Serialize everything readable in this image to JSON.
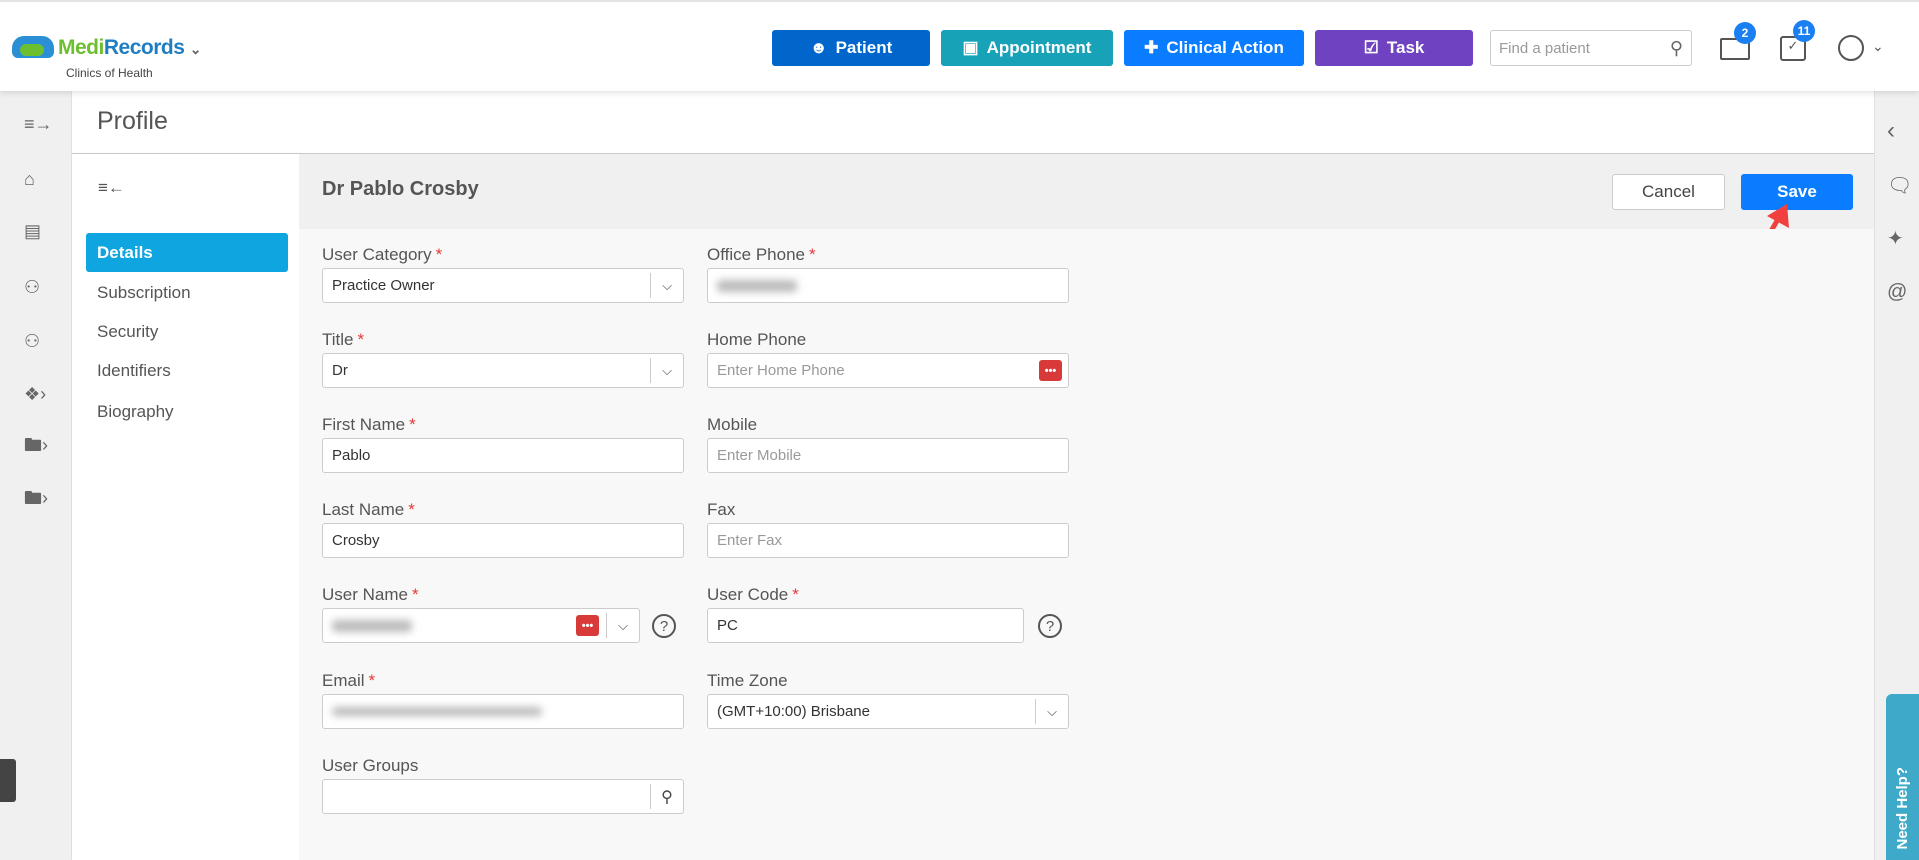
{
  "header": {
    "brand_medi": "Medi",
    "brand_records": "Records",
    "clinic": "Clinics of Health",
    "buttons": [
      {
        "label": "Patient",
        "color": "#0066cc"
      },
      {
        "label": "Appointment",
        "color": "#17a2b8"
      },
      {
        "label": "Clinical Action",
        "color": "#0a7cff"
      },
      {
        "label": "Task",
        "color": "#6f42c1"
      }
    ],
    "search_placeholder": "Find a patient",
    "mail_count": "2",
    "calendar_count": "11"
  },
  "page_title": "Profile",
  "subnav": [
    "Details",
    "Subscription",
    "Security",
    "Identifiers",
    "Biography"
  ],
  "profile_name": "Dr Pablo Crosby",
  "actions": {
    "cancel": "Cancel",
    "save": "Save"
  },
  "form": {
    "user_category": {
      "label": "User Category",
      "value": "Practice Owner"
    },
    "title": {
      "label": "Title",
      "value": "Dr"
    },
    "first_name": {
      "label": "First Name",
      "value": "Pablo"
    },
    "last_name": {
      "label": "Last Name",
      "value": "Crosby"
    },
    "user_name": {
      "label": "User Name"
    },
    "email": {
      "label": "Email"
    },
    "user_groups": {
      "label": "User Groups"
    },
    "office_phone": {
      "label": "Office Phone"
    },
    "home_phone": {
      "label": "Home Phone",
      "placeholder": "Enter Home Phone"
    },
    "mobile": {
      "label": "Mobile",
      "placeholder": "Enter Mobile"
    },
    "fax": {
      "label": "Fax",
      "placeholder": "Enter Fax"
    },
    "user_code": {
      "label": "User Code",
      "value": "PC"
    },
    "time_zone": {
      "label": "Time Zone",
      "value": "(GMT+10:00) Brisbane"
    }
  },
  "need_help": "Need Help?"
}
